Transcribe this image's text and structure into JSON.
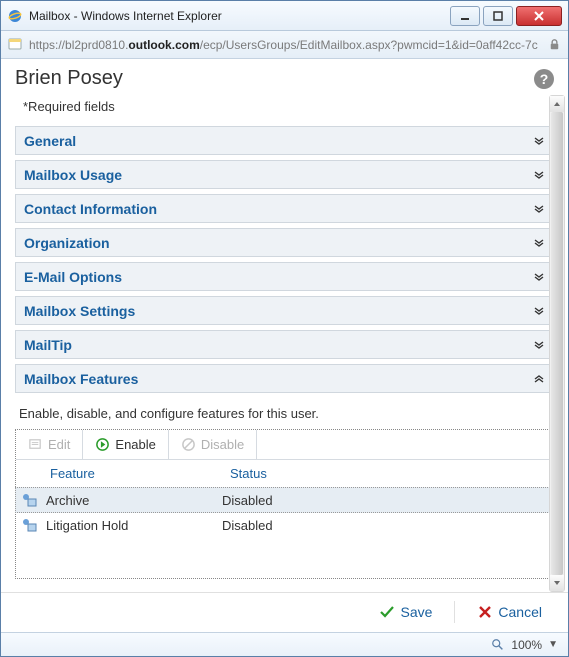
{
  "window": {
    "title": "Mailbox - Windows Internet Explorer",
    "address_prefix": "https://bl2prd0810.",
    "address_host": "outlook.com",
    "address_suffix": "/ecp/UsersGroups/EditMailbox.aspx?pwmcid=1&id=0aff42cc-7c"
  },
  "header": {
    "title": "Brien Posey"
  },
  "required_label": "*Required fields",
  "sections": [
    {
      "label": "General",
      "expanded": false
    },
    {
      "label": "Mailbox Usage",
      "expanded": false
    },
    {
      "label": "Contact Information",
      "expanded": false
    },
    {
      "label": "Organization",
      "expanded": false
    },
    {
      "label": "E-Mail Options",
      "expanded": false
    },
    {
      "label": "Mailbox Settings",
      "expanded": false
    },
    {
      "label": "MailTip",
      "expanded": false
    },
    {
      "label": "Mailbox Features",
      "expanded": true
    }
  ],
  "features": {
    "intro": "Enable, disable, and configure features for this user.",
    "toolbar": {
      "edit": "Edit",
      "enable": "Enable",
      "disable": "Disable"
    },
    "columns": {
      "feature": "Feature",
      "status": "Status"
    },
    "rows": [
      {
        "feature": "Archive",
        "status": "Disabled",
        "selected": true
      },
      {
        "feature": "Litigation Hold",
        "status": "Disabled",
        "selected": false
      }
    ]
  },
  "footer": {
    "save": "Save",
    "cancel": "Cancel"
  },
  "statusbar": {
    "zoom": "100%"
  }
}
